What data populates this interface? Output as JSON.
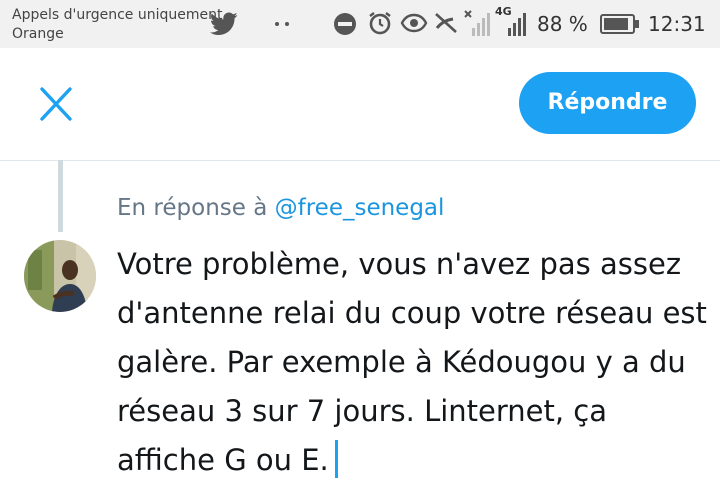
{
  "status_bar": {
    "carrier_line1": "Appels d'urgence uniquement",
    "carrier_line2": "Orange",
    "battery_percent": "88 %",
    "time": "12:31",
    "network_type": "4G",
    "icons": [
      "twitter-bird-icon",
      "dots-icon",
      "do-not-disturb-icon",
      "alarm-icon",
      "eye-icon",
      "call-disabled-icon",
      "no-signal-icon",
      "signal-4g-icon",
      "battery-icon"
    ]
  },
  "header": {
    "reply_label": "Répondre",
    "close_icon": "close-icon"
  },
  "reply": {
    "prefix": "En réponse à",
    "handle": "@free_senegal"
  },
  "compose": {
    "text": "Votre problème, vous n'avez pas assez d'antenne relai du coup votre réseau est galère. Par exemple à Kédougou y a du réseau 3 sur 7 jours. Linternet, ça affiche G ou E."
  },
  "colors": {
    "accent": "#1da1f2",
    "mention": "#1b95e0",
    "muted": "#657786",
    "status_bar_bg": "#f1f1f1"
  }
}
